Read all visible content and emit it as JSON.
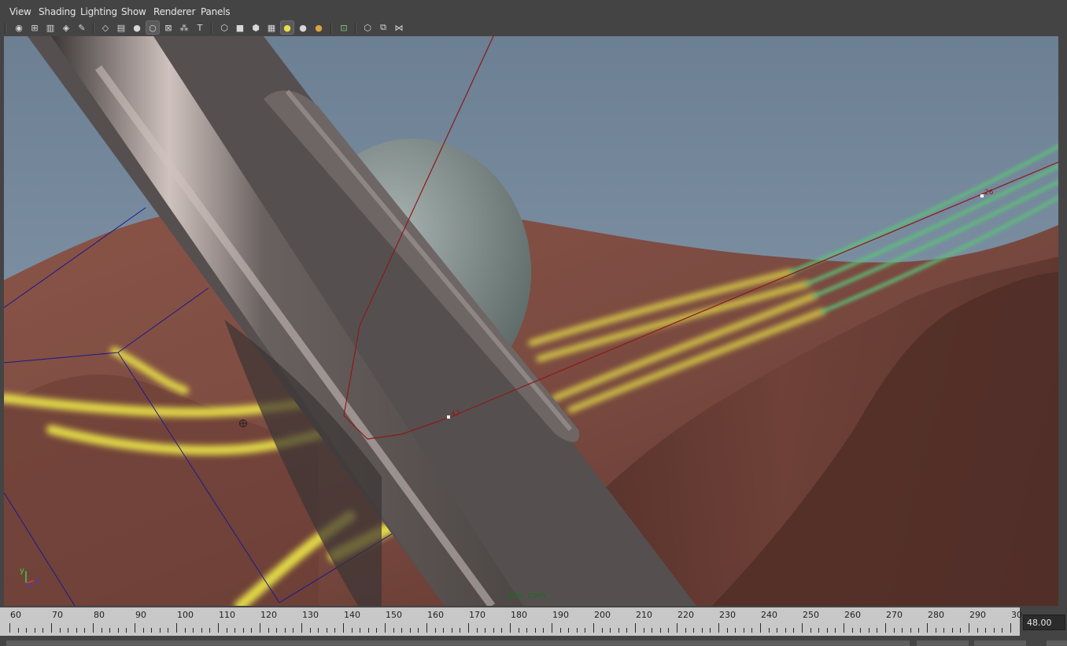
{
  "menu": [
    "View",
    "Shading",
    "Lighting",
    "Show",
    "Renderer",
    "Panels"
  ],
  "toolbar": {
    "groups": [
      [
        "camera-attributes-icon",
        "select-camera-icon",
        "bookmark-icon",
        "image-plane-icon",
        "2d-pan-zoom-icon"
      ],
      [
        "grid-icon",
        "film-gate-icon",
        "resolution-gate-icon",
        "gate-mask-icon",
        "field-chart-icon",
        "safe-action-icon",
        "safe-title-icon"
      ],
      [
        "wireframe-icon",
        "smooth-shade-icon",
        "wireframe-on-shaded-icon",
        "textured-icon",
        "use-all-lights-icon",
        "shadows-icon",
        "ambient-occlusion-icon"
      ],
      [
        "isolate-select-icon"
      ],
      [
        "xray-icon",
        "xray-active-icon",
        "xray-joints-icon"
      ]
    ]
  },
  "viewport": {
    "camera_label": "alin_cam",
    "point_labels": [
      "47",
      "26"
    ],
    "axis_labels": {
      "y": "y",
      "x": "x"
    },
    "colors": {
      "sky": "#6f8396",
      "terrain": "#7a4a40",
      "ship": "#5e5857",
      "curve": "#8a1a1a",
      "cage": "#1a1a8a",
      "particles_yellow": "#e8e04a",
      "particles_green": "#5fbf7a"
    }
  },
  "timeline": {
    "ticks": [
      "60",
      "70",
      "80",
      "90",
      "100",
      "110",
      "120",
      "130",
      "140",
      "150",
      "160",
      "170",
      "180",
      "190",
      "200",
      "210",
      "220",
      "230",
      "240",
      "250",
      "260",
      "270",
      "280",
      "290",
      "30"
    ],
    "current_frame": "48.00"
  }
}
